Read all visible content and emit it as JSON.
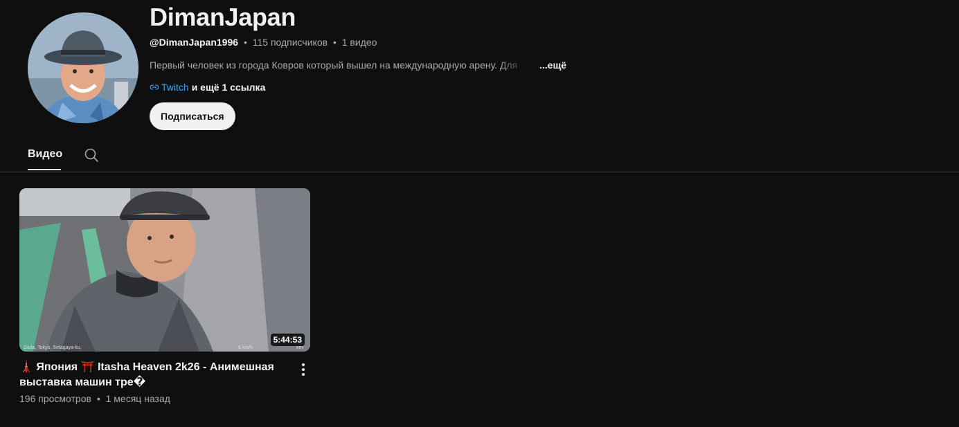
{
  "channel": {
    "name": "DimanJapan",
    "handle": "@DimanJapan1996",
    "subscribers": "115 подписчиков",
    "video_count": "1 видео",
    "separator": "•",
    "description": "Первый человек из города Ковров который вышел на международную арену. Для",
    "more_label": "...ещё",
    "link_text": "Twitch",
    "more_links": "и ещё 1 ссылка",
    "subscribe_label": "Подписаться"
  },
  "tabs": {
    "videos_label": "Видео"
  },
  "video": {
    "title": "🗼 Япония ⛩️ Itasha Heaven 2k26 - Анимешная выставка машин тре�",
    "duration": "5:44:53",
    "views": "196 просмотров",
    "age": "1 месяц назад",
    "separator": "•",
    "overlay_location": "Daita, Tokyo, Setagaya-ku,",
    "overlay_speed": "6 km/h",
    "overlay_distance": "0.2 km"
  },
  "colors": {
    "background": "#0f0f0f",
    "text_primary": "#f1f1f1",
    "text_secondary": "#aaaaaa",
    "link": "#3ea6ff",
    "subscribe_bg": "#f1f1f1"
  },
  "icons": [
    "avatar-image",
    "link-icon",
    "search-icon",
    "more-vert-icon"
  ]
}
